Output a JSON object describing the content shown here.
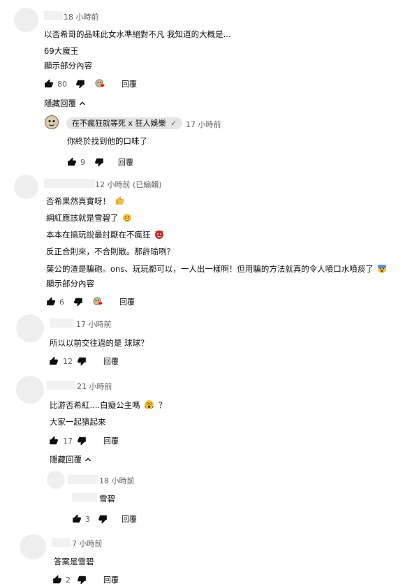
{
  "comments": {
    "c1": {
      "time": "18 小時前",
      "lines": [
        "以否希哥的品味此女水準絕對不凡 我知道的大概是...",
        "69大魔王"
      ],
      "show_more": "顯示部分內容",
      "likes": "80",
      "reply": "回覆",
      "hide_replies": "隱藏回覆",
      "reply1": {
        "author": "在不瘋狂就等死 x 狂人娛樂",
        "time": "17 小時前",
        "text": "你終於找到他的口味了",
        "likes": "9",
        "reply": "回覆"
      }
    },
    "c2": {
      "time": "12 小時前 (已編輯)",
      "lines": [
        "否希果然真實呀！",
        "網紅應該就是雪碧了",
        "本本在搞玩說最討厭在不瘋狂",
        "反正合則來，不合則散。那許瑜咧？",
        "葉公的渣是騙砲。ons、玩玩都可以，一人出一樣啊！但用騙的方法就真的令人噴口水噴痰了"
      ],
      "show_more": "顯示部分內容",
      "likes": "6",
      "reply": "回覆"
    },
    "c3": {
      "time": "17 小時前",
      "text": "所以以前交往過的是 球球？",
      "likes": "12",
      "reply": "回覆"
    },
    "c4": {
      "time": "21 小時前",
      "lines": [
        "比游否希紅....白癡公主嗎",
        "大家一起猜起來"
      ],
      "question": "？",
      "likes": "17",
      "reply": "回覆",
      "hide_replies": "隱藏回覆",
      "reply1": {
        "time": "18 小時前",
        "text": "雪碧",
        "likes": "3",
        "reply": "回覆"
      }
    },
    "c5": {
      "time": "7 小時前",
      "text": "答案是雪碧",
      "likes": "2",
      "reply": "回覆"
    }
  },
  "colors": {
    "text": "#0f0f0f",
    "secondary": "#606060",
    "heart": "#ff0000",
    "chip_bg": "#e5e5e5",
    "placeholder": "#eeeeee"
  },
  "icons": [
    "thumbs-up-icon",
    "thumbs-down-icon",
    "chevron-up-icon",
    "creator-heart-icon",
    "thumbs-up-emoji-icon",
    "grinning-emoji-icon",
    "devil-emoji-icon",
    "scared-emoji-icon",
    "shocked-emoji-icon"
  ]
}
